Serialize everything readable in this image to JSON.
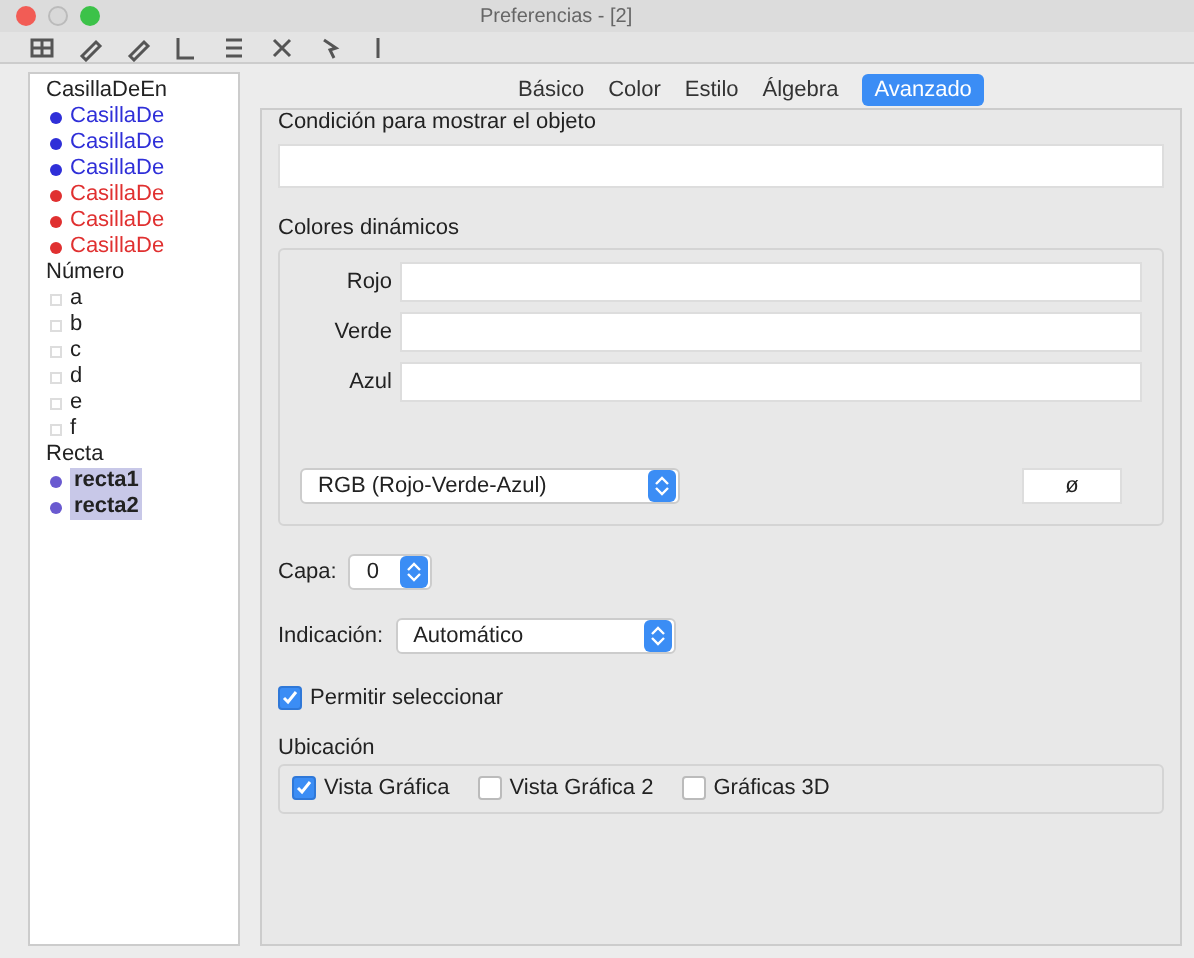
{
  "window": {
    "title": "Preferencias - [2]"
  },
  "tree": [
    {
      "label": "CasillaDeEn",
      "children": [
        {
          "label": "CasillaDe",
          "color": "#2f2fd8",
          "selected": false
        },
        {
          "label": "CasillaDe",
          "color": "#2f2fd8",
          "selected": false
        },
        {
          "label": "CasillaDe",
          "color": "#2f2fd8",
          "selected": false
        },
        {
          "label": "CasillaDe",
          "color": "#e03030",
          "selected": false
        },
        {
          "label": "CasillaDe",
          "color": "#e03030",
          "selected": false
        },
        {
          "label": "CasillaDe",
          "color": "#e03030",
          "selected": false
        }
      ]
    },
    {
      "label": "Número",
      "children": [
        {
          "label": "a",
          "selected": false
        },
        {
          "label": "b",
          "selected": false
        },
        {
          "label": "c",
          "selected": false
        },
        {
          "label": "d",
          "selected": false
        },
        {
          "label": "e",
          "selected": false
        },
        {
          "label": "f",
          "selected": false
        }
      ]
    },
    {
      "label": "Recta",
      "children": [
        {
          "label": "recta1",
          "color": "#6a5ad0",
          "selected": true
        },
        {
          "label": "recta2",
          "color": "#6a5ad0",
          "selected": true
        }
      ]
    }
  ],
  "tabs": [
    {
      "label": "Básico",
      "selected": false
    },
    {
      "label": "Color",
      "selected": false
    },
    {
      "label": "Estilo",
      "selected": false
    },
    {
      "label": "Álgebra",
      "selected": false
    },
    {
      "label": "Avanzado",
      "selected": true
    }
  ],
  "condition": {
    "label": "Condición para mostrar el objeto"
  },
  "dynamic_colors": {
    "label": "Colores dinámicos",
    "fields": [
      {
        "label": "Rojo"
      },
      {
        "label": "Verde"
      },
      {
        "label": "Azul"
      }
    ],
    "model": "RGB (Rojo-Verde-Azul)",
    "button": "ø"
  },
  "layer": {
    "label": "Capa:",
    "value": "0"
  },
  "tooltip": {
    "label": "Indicación:",
    "value": "Automático"
  },
  "selectable": {
    "label": "Permitir seleccionar",
    "checked": true
  },
  "location": {
    "label": "Ubicación",
    "options": [
      {
        "label": "Vista Gráfica",
        "checked": true
      },
      {
        "label": "Vista Gráfica 2",
        "checked": false
      },
      {
        "label": "Gráficas 3D",
        "checked": false
      }
    ]
  }
}
